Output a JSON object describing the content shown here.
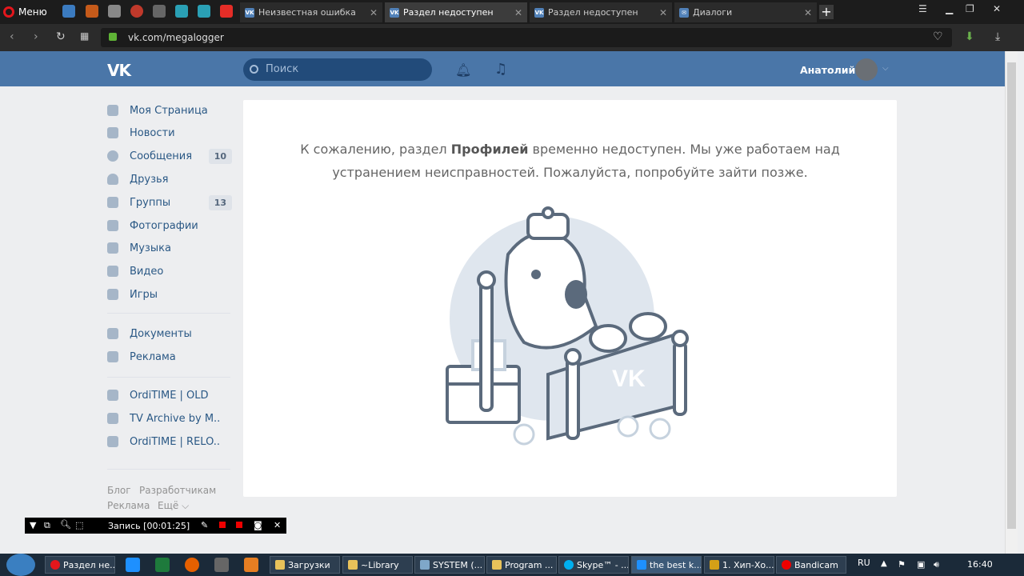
{
  "browser": {
    "menu_label": "Меню",
    "tabs": [
      {
        "title": "Неизвестная ошибка"
      },
      {
        "title": "Раздел недоступен"
      },
      {
        "title": "Раздел недоступен"
      },
      {
        "title": "Диалоги"
      }
    ],
    "url": "vk.com/megalogger"
  },
  "vk": {
    "logo": "VK",
    "search_placeholder": "Поиск",
    "user_name": "Анатолий",
    "menu": [
      {
        "label": "Моя Страница",
        "icon": "home-icon"
      },
      {
        "label": "Новости",
        "icon": "news-icon"
      },
      {
        "label": "Сообщения",
        "icon": "messages-icon",
        "count": "10"
      },
      {
        "label": "Друзья",
        "icon": "friends-icon"
      },
      {
        "label": "Группы",
        "icon": "groups-icon",
        "count": "13"
      },
      {
        "label": "Фотографии",
        "icon": "camera-icon"
      },
      {
        "label": "Музыка",
        "icon": "music-icon"
      },
      {
        "label": "Видео",
        "icon": "video-icon"
      },
      {
        "label": "Игры",
        "icon": "gamepad-icon"
      },
      {
        "label": "Документы",
        "icon": "document-icon"
      },
      {
        "label": "Реклама",
        "icon": "megaphone-icon"
      },
      {
        "label": "OrdiTIME | OLD",
        "icon": "group-icon"
      },
      {
        "label": "TV Archive by M..",
        "icon": "group-icon"
      },
      {
        "label": "OrdiTIME | RELO..",
        "icon": "group-icon"
      }
    ],
    "footer": {
      "blog": "Блог",
      "developers": "Разработчикам",
      "ads": "Реклама",
      "more": "Ещё ⌵"
    },
    "error": {
      "before": "К сожалению, раздел ",
      "bold": "Профилей",
      "after": " временно недоступен. Мы уже работаем над устранением неисправностей. Пожалуйста, попробуйте зайти позже."
    },
    "illustration_logo": "VK"
  },
  "recorder": {
    "label": "Запись [00:01:25]"
  },
  "taskbar": {
    "buttons": [
      "Раздел не...",
      "Загрузки",
      "~Library",
      "SYSTEM (...",
      "Program ...",
      "Skype™ - ...",
      "the best k...",
      "1. Хип-Хо...",
      "Bandicam"
    ],
    "lang": "RU",
    "time": "16:40"
  },
  "colors": {
    "vk_blue": "#4a76a8",
    "link": "#2a5885",
    "illustration": "#c6d2de"
  }
}
